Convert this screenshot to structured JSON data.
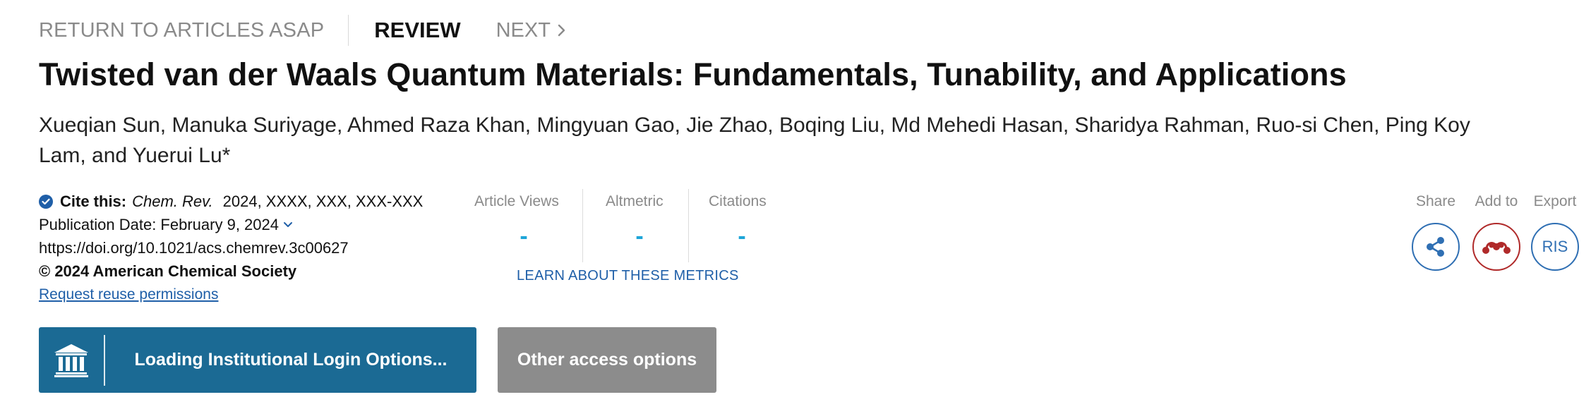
{
  "nav": {
    "return_label": "RETURN TO ARTICLES ASAP",
    "current_label": "REVIEW",
    "next_label": "NEXT"
  },
  "article": {
    "title": "Twisted van der Waals Quantum Materials: Fundamentals, Tunability, and Applications",
    "authors": "Xueqian Sun, Manuka Suriyage, Ahmed Raza Khan, Mingyuan Gao, Jie Zhao, Boqing Liu, Md Mehedi Hasan, Sharidya Rahman, Ruo-si Chen, Ping Koy Lam, and Yuerui Lu*"
  },
  "citation": {
    "label": "Cite this:",
    "journal": "Chem. Rev.",
    "details": "2024, XXXX, XXX, XXX-XXX",
    "publication_date": "Publication Date: February 9, 2024",
    "doi": "https://doi.org/10.1021/acs.chemrev.3c00627",
    "copyright": "© 2024 American Chemical Society",
    "reuse_link": "Request reuse permissions"
  },
  "metrics": {
    "items": [
      {
        "label": "Article Views",
        "value": "-"
      },
      {
        "label": "Altmetric",
        "value": "-"
      },
      {
        "label": "Citations",
        "value": "-"
      }
    ],
    "learn_link": "LEARN ABOUT THESE METRICS",
    "value_color": "#1ea5d8"
  },
  "tools": {
    "share_label": "Share",
    "add_label": "Add to",
    "export_label": "Export",
    "export_button": "RIS",
    "share_icon": "share-icon",
    "add_icon": "mendeley-icon"
  },
  "access": {
    "institutional_label": "Loading Institutional Login Options...",
    "other_label": "Other access options",
    "institution_icon": "institution-icon"
  },
  "colors": {
    "primary_blue": "#1b6a94",
    "link_blue": "#1f5fa8",
    "mendeley_red": "#b02a2a",
    "grey_button": "#8c8c8c"
  }
}
